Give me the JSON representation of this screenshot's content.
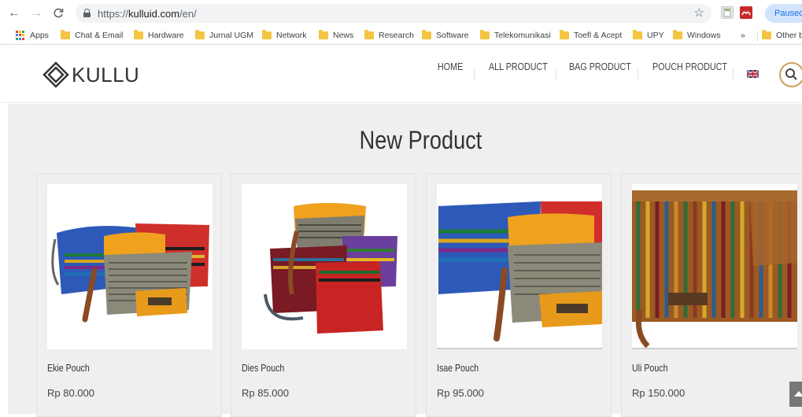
{
  "browser": {
    "url_prefix": "https://",
    "url_domain": "kulluid.com",
    "url_path": "/en/",
    "profile_status": "Paused",
    "bookmarks": [
      {
        "label": "Apps",
        "icon": "apps-grid-icon"
      },
      {
        "label": "Chat & Email",
        "icon": "folder-icon"
      },
      {
        "label": "Hardware",
        "icon": "folder-icon"
      },
      {
        "label": "Jurnal UGM",
        "icon": "folder-icon"
      },
      {
        "label": "Network",
        "icon": "folder-icon"
      },
      {
        "label": "News",
        "icon": "folder-icon"
      },
      {
        "label": "Research",
        "icon": "folder-icon"
      },
      {
        "label": "Software",
        "icon": "folder-icon"
      },
      {
        "label": "Telekomunikasi",
        "icon": "folder-icon"
      },
      {
        "label": "Toefl & Acept",
        "icon": "folder-icon"
      },
      {
        "label": "UPY",
        "icon": "folder-icon"
      },
      {
        "label": "Windows",
        "icon": "folder-icon"
      }
    ],
    "overflow_label": "»",
    "other_bookmarks": "Other b"
  },
  "site": {
    "logo_text": "KULLU",
    "menu": [
      "HOME",
      "ALL PRODUCT",
      "BAG PRODUCT",
      "POUCH PRODUCT"
    ],
    "language_flag": "uk-flag-icon",
    "accent_color": "#c8a062"
  },
  "section": {
    "title": "New Product"
  },
  "products": [
    {
      "name": "Ekie Pouch",
      "price": "Rp 80.000"
    },
    {
      "name": "Dies Pouch",
      "price": "Rp 85.000"
    },
    {
      "name": "Isae Pouch",
      "price": "Rp 95.000"
    },
    {
      "name": "Uli Pouch",
      "price": "Rp 150.000"
    }
  ]
}
